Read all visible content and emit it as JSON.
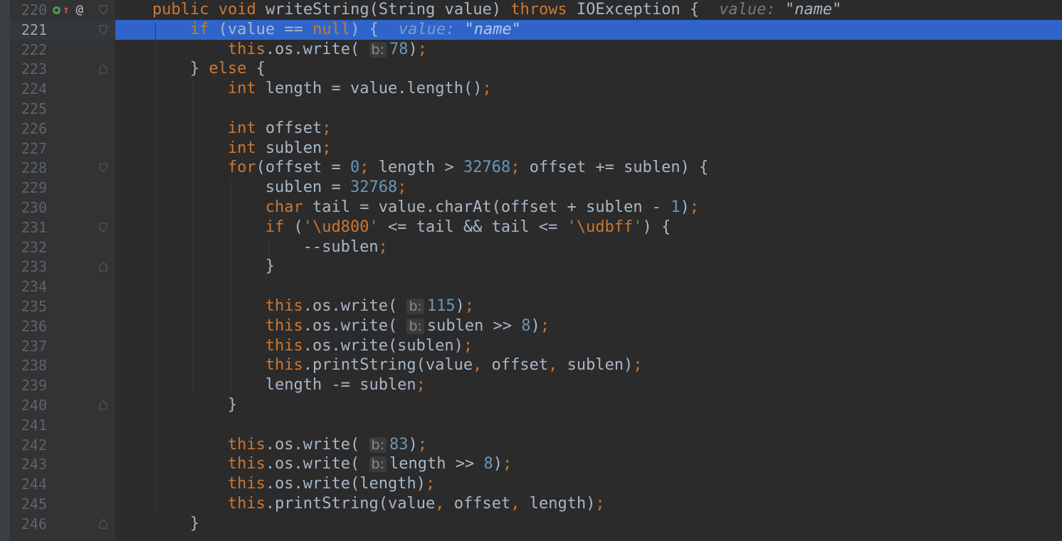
{
  "editor": {
    "current_line": 221,
    "lines": [
      {
        "n": "220",
        "tokens": [
          [
            "kw",
            "public void "
          ],
          [
            "id",
            "writeString(String value) "
          ],
          [
            "kw",
            "throws "
          ],
          [
            "id",
            "IOException {"
          ]
        ],
        "inline": {
          "label": "value: ",
          "value": "\"name\""
        }
      },
      {
        "n": "221",
        "tokens": [
          [
            "kw",
            "if "
          ],
          [
            "id",
            "(value == "
          ],
          [
            "kw",
            "null"
          ],
          [
            "id",
            ") {"
          ]
        ],
        "inline": {
          "label": "value: ",
          "value": "\"name\""
        }
      },
      {
        "n": "222",
        "tokens": [
          [
            "kw",
            "this"
          ],
          [
            "id",
            ".os.write( "
          ],
          [
            "hint",
            "b:"
          ],
          [
            "num",
            "78"
          ],
          [
            "id",
            ")"
          ],
          [
            "punc",
            ";"
          ]
        ]
      },
      {
        "n": "223",
        "tokens": [
          [
            "id",
            "} "
          ],
          [
            "kw",
            "else "
          ],
          [
            "id",
            "{"
          ]
        ]
      },
      {
        "n": "224",
        "tokens": [
          [
            "kw",
            "int "
          ],
          [
            "id",
            "length = value.length()"
          ],
          [
            "punc",
            ";"
          ]
        ]
      },
      {
        "n": "225",
        "tokens": []
      },
      {
        "n": "226",
        "tokens": [
          [
            "kw",
            "int "
          ],
          [
            "id",
            "offset"
          ],
          [
            "punc",
            ";"
          ]
        ]
      },
      {
        "n": "227",
        "tokens": [
          [
            "kw",
            "int "
          ],
          [
            "id",
            "sublen"
          ],
          [
            "punc",
            ";"
          ]
        ]
      },
      {
        "n": "228",
        "tokens": [
          [
            "kw",
            "for"
          ],
          [
            "id",
            "(offset = "
          ],
          [
            "num",
            "0"
          ],
          [
            "punc",
            "; "
          ],
          [
            "id",
            "length > "
          ],
          [
            "num",
            "32768"
          ],
          [
            "punc",
            "; "
          ],
          [
            "id",
            "offset += sublen) {"
          ]
        ]
      },
      {
        "n": "229",
        "tokens": [
          [
            "id",
            "sublen = "
          ],
          [
            "num",
            "32768"
          ],
          [
            "punc",
            ";"
          ]
        ]
      },
      {
        "n": "230",
        "tokens": [
          [
            "kw",
            "char "
          ],
          [
            "id",
            "tail = value.charAt(offset + sublen - "
          ],
          [
            "num",
            "1"
          ],
          [
            "id",
            ")"
          ],
          [
            "punc",
            ";"
          ]
        ]
      },
      {
        "n": "231",
        "tokens": [
          [
            "kw",
            "if "
          ],
          [
            "id",
            "("
          ],
          [
            "str",
            "'"
          ],
          [
            "kw",
            "\\ud800"
          ],
          [
            "str",
            "'"
          ],
          [
            "id",
            " <= tail && tail <= "
          ],
          [
            "str",
            "'"
          ],
          [
            "kw",
            "\\udbff"
          ],
          [
            "str",
            "'"
          ],
          [
            "id",
            ") {"
          ]
        ]
      },
      {
        "n": "232",
        "tokens": [
          [
            "id",
            "--sublen"
          ],
          [
            "punc",
            ";"
          ]
        ]
      },
      {
        "n": "233",
        "tokens": [
          [
            "id",
            "}"
          ]
        ]
      },
      {
        "n": "234",
        "tokens": []
      },
      {
        "n": "235",
        "tokens": [
          [
            "kw",
            "this"
          ],
          [
            "id",
            ".os.write( "
          ],
          [
            "hint",
            "b:"
          ],
          [
            "num",
            "115"
          ],
          [
            "id",
            ")"
          ],
          [
            "punc",
            ";"
          ]
        ]
      },
      {
        "n": "236",
        "tokens": [
          [
            "kw",
            "this"
          ],
          [
            "id",
            ".os.write( "
          ],
          [
            "hint",
            "b:"
          ],
          [
            "id",
            "sublen >> "
          ],
          [
            "num",
            "8"
          ],
          [
            "id",
            ")"
          ],
          [
            "punc",
            ";"
          ]
        ]
      },
      {
        "n": "237",
        "tokens": [
          [
            "kw",
            "this"
          ],
          [
            "id",
            ".os.write(sublen)"
          ],
          [
            "punc",
            ";"
          ]
        ]
      },
      {
        "n": "238",
        "tokens": [
          [
            "kw",
            "this"
          ],
          [
            "id",
            ".printString(value"
          ],
          [
            "punc",
            ", "
          ],
          [
            "id",
            "offset"
          ],
          [
            "punc",
            ", "
          ],
          [
            "id",
            "sublen)"
          ],
          [
            "punc",
            ";"
          ]
        ]
      },
      {
        "n": "239",
        "tokens": [
          [
            "id",
            "length -= sublen"
          ],
          [
            "punc",
            ";"
          ]
        ]
      },
      {
        "n": "240",
        "tokens": [
          [
            "id",
            "}"
          ]
        ]
      },
      {
        "n": "241",
        "tokens": []
      },
      {
        "n": "242",
        "tokens": [
          [
            "kw",
            "this"
          ],
          [
            "id",
            ".os.write( "
          ],
          [
            "hint",
            "b:"
          ],
          [
            "num",
            "83"
          ],
          [
            "id",
            ")"
          ],
          [
            "punc",
            ";"
          ]
        ]
      },
      {
        "n": "243",
        "tokens": [
          [
            "kw",
            "this"
          ],
          [
            "id",
            ".os.write( "
          ],
          [
            "hint",
            "b:"
          ],
          [
            "id",
            "length >> "
          ],
          [
            "num",
            "8"
          ],
          [
            "id",
            ")"
          ],
          [
            "punc",
            ";"
          ]
        ]
      },
      {
        "n": "244",
        "tokens": [
          [
            "kw",
            "this"
          ],
          [
            "id",
            ".os.write(length)"
          ],
          [
            "punc",
            ";"
          ]
        ]
      },
      {
        "n": "245",
        "tokens": [
          [
            "kw",
            "this"
          ],
          [
            "id",
            ".printString(value"
          ],
          [
            "punc",
            ", "
          ],
          [
            "id",
            "offset"
          ],
          [
            "punc",
            ", "
          ],
          [
            "id",
            "length)"
          ],
          [
            "punc",
            ";"
          ]
        ]
      },
      {
        "n": "246",
        "tokens": [
          [
            "id",
            "}"
          ]
        ]
      }
    ],
    "gutter_icons": {
      "implements": "implements-icon",
      "override": "overrides-up-arrow-icon",
      "annotation": "@"
    },
    "colors": {
      "background": "#2b2b2b",
      "gutter": "#313335",
      "selection": "#2f65ca",
      "keyword": "#cc7832",
      "number": "#6897bb",
      "string": "#6a8759",
      "text": "#a9b7c6"
    }
  }
}
